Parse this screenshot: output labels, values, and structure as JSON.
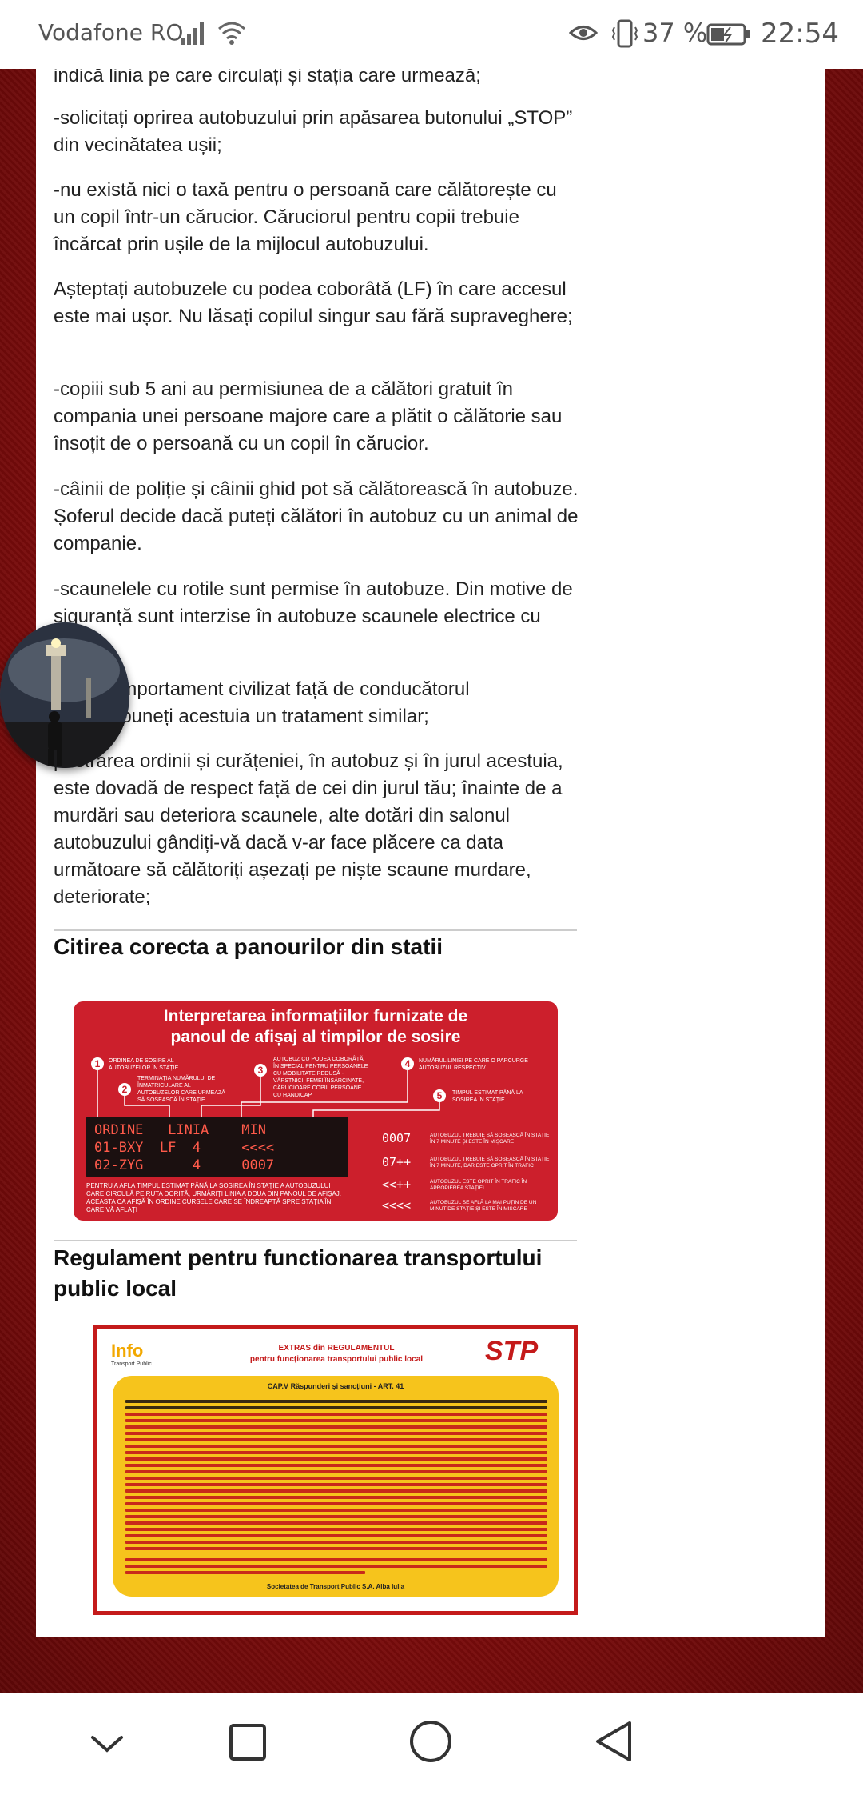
{
  "status_bar": {
    "carrier": "Vodafone RO",
    "battery_percent": "37 %",
    "time": "22:54",
    "icons": [
      "signal-icon",
      "wifi-icon",
      "eye-comfort-icon",
      "vibrate-icon",
      "battery-icon"
    ]
  },
  "article": {
    "paragraphs": [
      "indică linia pe care circulați și stația care urmează;",
      "-solicitați oprirea autobuzului prin apăsarea butonului „STOP” din vecinătatea ușii;",
      "-nu există nici o taxă pentru o persoană care călătorește cu un copil într-un cărucior. Căruciorul pentru copii trebuie încărcat prin ușile de la mijlocul autobuzului.",
      "Așteptați autobuzele cu podea coborâtă (LF) în care accesul este mai ușor. Nu lăsați copilul singur sau fără supraveghere;",
      "-copiii sub 5 ani au permisiunea de a călători gratuit în compania unei persoane majore care a plătit o călătorie sau însoțit de o persoană cu un copil în cărucior.",
      "-câinii de poliție și câinii ghid pot să călătorească în autobuze. Șoferul decide dacă puteți călători în autobuz cu un animal de companie.",
      "-scaunelele cu rotile sunt permise în autobuze. Din motive de siguranță sunt interzise în autobuze scaunele electrice cu",
      "comportament civilizat față de conducătorul",
      "impuneți acestuia un tratament similar;",
      "păstrarea ordinii și curățeniei, în autobuz și în jurul acestuia, este dovadă de respect față de cei din jurul tău; înainte de a murdări sau deteriora scaunele, alte dotări din salonul autobuzului gândiți-vă dacă v-ar face plăcere ca data următoare să călătoriți așezați pe niște scaune murdare, deteriorate;"
    ],
    "heading_panels": "Citirea corecta a panourilor din statii",
    "heading_regulation": "Regulament pentru functionarea transportului public local"
  },
  "arrival_panel": {
    "title_line1": "Interpretarea informațiilor furnizate de",
    "title_line2": "panoul de afișaj al timpilor de sosire",
    "callouts": [
      {
        "n": "1",
        "text": "ORDINEA DE SOSIRE AL AUTOBUZELOR ÎN STAȚIE"
      },
      {
        "n": "2",
        "text": "TERMINAȚIA NUMĂRULUI DE ÎNMATRICULARE AL AUTOBUZELOR CARE URMEAZĂ SĂ SOSEASCĂ ÎN STAȚIE"
      },
      {
        "n": "3",
        "text": "AUTOBUZ CU PODEA COBORÂTĂ ÎN SPECIAL PENTRU PERSOANELE CU MOBILITATE REDUSĂ - VÂRSTNICI, FEMEI ÎNSĂRCINATE, CĂRUCIOARE COPII, PERSOANE CU HANDICAP"
      },
      {
        "n": "4",
        "text": "NUMĂRUL LINIEI PE CARE O PARCURGE AUTOBUZUL RESPECTIV"
      },
      {
        "n": "5",
        "text": "TIMPUL ESTIMAT PÂNĂ LA SOSIREA ÎN STAȚIE"
      }
    ],
    "led_rows": [
      "ORDINE   LINIA    MIN",
      "01-BXY  LF  4     <<<<",
      "02-ZYG      4     0007"
    ],
    "legend": [
      {
        "code": "0007",
        "desc": "AUTOBUZUL TREBUIE SĂ SOSEASCĂ ÎN STAȚIE ÎN 7 MINUTE ȘI ESTE ÎN MIȘCARE"
      },
      {
        "code": "07++",
        "desc": "AUTOBUZUL TREBUIE SĂ SOSEASCĂ ÎN STAȚIE ÎN 7 MINUTE, DAR ESTE OPRIT ÎN TRAFIC"
      },
      {
        "code": "<<++",
        "desc": "AUTOBUZUL ESTE OPRIT ÎN TRAFIC ÎN APROPIEREA STAȚIEI"
      },
      {
        "code": "<<<<",
        "desc": "AUTOBUZUL SE AFLĂ LA MAI PUȚIN DE UN MINUT DE STAȚIE ȘI ESTE ÎN MIȘCARE"
      }
    ],
    "bottom_text": "PENTRU A AFLA TIMPUL ESTIMAT PÂNĂ LA SOSIREA ÎN STAȚIE A AUTOBUZULUI CARE CIRCULĂ PE RUTA DORITĂ, URMĂRIȚI LINIA A DOUA DIN PANOUL DE AFIȘAJ. ACEASTA CA AFIȘĂ ÎN ORDINE CURSELE CARE SE ÎNDREAPTĂ SPRE STAȚIA ÎN CARE VĂ AFLAȚI"
  },
  "regulation_image": {
    "logo": "Info",
    "logo_sub": "Transport Public",
    "title_line1": "EXTRAS din REGULAMENTUL",
    "title_line2": "pentru funcționarea transportului public local",
    "brand": "STP",
    "chapter": "CAP.V Răspunderi și sancțiuni - ART. 41",
    "footer": "Societatea de Transport Public S.A. Alba Iulia"
  },
  "colors": {
    "accent_red": "#cc1f2c",
    "page_bg_red": "#8a0e0e",
    "reg_yellow": "#f6c41c"
  },
  "nav_bar": {
    "icons": [
      "chevron-down-icon",
      "recents-square-icon",
      "home-circle-icon",
      "back-triangle-icon"
    ]
  }
}
